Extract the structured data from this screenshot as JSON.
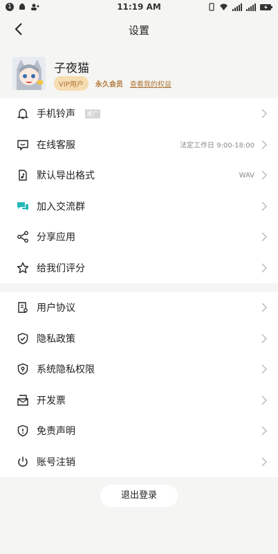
{
  "status_bar": {
    "time": "11:19 AM",
    "left_icons": [
      "notification-icon",
      "android-icon",
      "user-icon"
    ],
    "right_icons": [
      "vibrate-icon",
      "wifi-icon",
      "signal-icon",
      "signal-icon",
      "battery-icon"
    ]
  },
  "header": {
    "title": "设置"
  },
  "profile": {
    "name": "子夜猫",
    "vip_label": "VIP用户",
    "membership": "永久会员",
    "benefits_link": "查看我的权益"
  },
  "group1": [
    {
      "label": "手机铃声",
      "tag": "推广",
      "value": "",
      "icon": "bell-icon"
    },
    {
      "label": "在线客服",
      "value": "法定工作日 9:00-18:00",
      "icon": "chat-icon"
    },
    {
      "label": "默认导出格式",
      "value": "WAV",
      "icon": "music-file-icon"
    },
    {
      "label": "加入交流群",
      "value": "",
      "icon": "group-chat-icon"
    },
    {
      "label": "分享应用",
      "value": "",
      "icon": "share-icon"
    },
    {
      "label": "给我们评分",
      "value": "",
      "icon": "star-icon"
    }
  ],
  "group2": [
    {
      "label": "用户协议",
      "icon": "document-icon"
    },
    {
      "label": "隐私政策",
      "icon": "shield-check-icon"
    },
    {
      "label": "系统隐私权限",
      "icon": "shield-lock-icon"
    },
    {
      "label": "开发票",
      "icon": "invoice-icon"
    },
    {
      "label": "免责声明",
      "icon": "info-shield-icon"
    },
    {
      "label": "账号注销",
      "icon": "power-icon"
    }
  ],
  "logout": "退出登录",
  "colors": {
    "accent": "#b0763a",
    "vip_bg": "#f6dcb1",
    "teal": "#26b7b7"
  }
}
